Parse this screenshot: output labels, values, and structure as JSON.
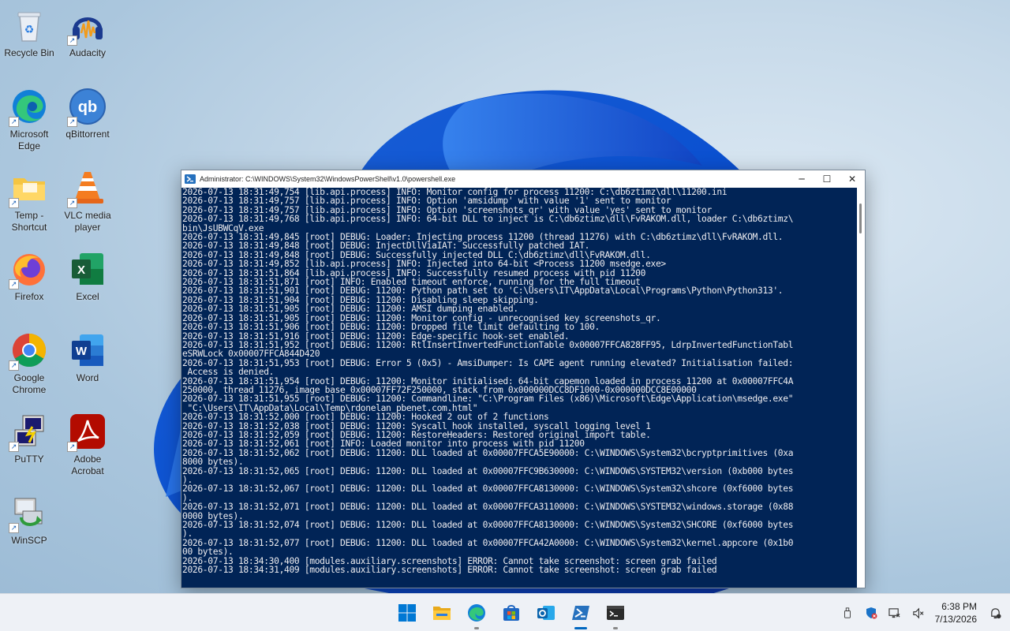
{
  "desktop_icons": [
    {
      "label": "Recycle Bin",
      "icon": "recycle-bin-icon"
    },
    {
      "label": "Audacity",
      "icon": "audacity-icon"
    },
    {
      "label": "Microsoft Edge",
      "icon": "edge-icon"
    },
    {
      "label": "qBittorrent",
      "icon": "qbittorrent-icon"
    },
    {
      "label": "Temp - Shortcut",
      "icon": "folder-icon"
    },
    {
      "label": "VLC media player",
      "icon": "vlc-icon"
    },
    {
      "label": "Firefox",
      "icon": "firefox-icon"
    },
    {
      "label": "Excel",
      "icon": "excel-icon"
    },
    {
      "label": "Google Chrome",
      "icon": "chrome-icon"
    },
    {
      "label": "Word",
      "icon": "word-icon"
    },
    {
      "label": "PuTTY",
      "icon": "putty-icon"
    },
    {
      "label": "Adobe Acrobat",
      "icon": "acrobat-icon"
    },
    {
      "label": "WinSCP",
      "icon": "winscp-icon"
    }
  ],
  "window": {
    "title": "Administrator: C:\\WINDOWS\\System32\\WindowsPowerShell\\v1.0\\powershell.exe",
    "minimize": "─",
    "maximize": "☐",
    "close": "✕"
  },
  "console_text": "2026-07-13 18:31:49,754 [lib.api.process] INFO: Monitor config for process 11200: C:\\db6ztimz\\dll\\11200.ini\n2026-07-13 18:31:49,757 [lib.api.process] INFO: Option 'amsidump' with value '1' sent to monitor\n2026-07-13 18:31:49,757 [lib.api.process] INFO: Option 'screenshots_qr' with value 'yes' sent to monitor\n2026-07-13 18:31:49,768 [lib.api.process] INFO: 64-bit DLL to inject is C:\\db6ztimz\\dll\\FvRAKOM.dll, loader C:\\db6ztimz\\\nbin\\JsUBWCqV.exe\n2026-07-13 18:31:49,845 [root] DEBUG: Loader: Injecting process 11200 (thread 11276) with C:\\db6ztimz\\dll\\FvRAKOM.dll.\n2026-07-13 18:31:49,848 [root] DEBUG: InjectDllViaIAT: Successfully patched IAT.\n2026-07-13 18:31:49,848 [root] DEBUG: Successfully injected DLL C:\\db6ztimz\\dll\\FvRAKOM.dll.\n2026-07-13 18:31:49,852 [lib.api.process] INFO: Injected into 64-bit <Process 11200 msedge.exe>\n2026-07-13 18:31:51,864 [lib.api.process] INFO: Successfully resumed process with pid 11200\n2026-07-13 18:31:51,871 [root] INFO: Enabled timeout enforce, running for the full timeout\n2026-07-13 18:31:51,901 [root] DEBUG: 11200: Python path set to 'C:\\Users\\IT\\AppData\\Local\\Programs\\Python\\Python313'.\n2026-07-13 18:31:51,904 [root] DEBUG: 11200: Disabling sleep skipping.\n2026-07-13 18:31:51,905 [root] DEBUG: 11200: AMSI dumping enabled.\n2026-07-13 18:31:51,905 [root] DEBUG: 11200: Monitor config - unrecognised key screenshots_qr.\n2026-07-13 18:31:51,906 [root] DEBUG: 11200: Dropped file limit defaulting to 100.\n2026-07-13 18:31:51,916 [root] DEBUG: 11200: Edge-specific hook-set enabled.\n2026-07-13 18:31:51,952 [root] DEBUG: 11200: RtlInsertInvertedFunctionTable 0x00007FFCA828FF95, LdrpInvertedFunctionTabl\neSRWLock 0x00007FFCA844D420\n2026-07-13 18:31:51,953 [root] DEBUG: Error 5 (0x5) - AmsiDumper: Is CAPE agent running elevated? Initialisation failed:\n Access is denied.\n2026-07-13 18:31:51,954 [root] DEBUG: 11200: Monitor initialised: 64-bit capemon loaded in process 11200 at 0x00007FFC4A\n250000, thread 11276, image base 0x00007FF72F250000, stack from 0x000000DCC8DF1000-0x000000DCC8E00000\n2026-07-13 18:31:51,955 [root] DEBUG: 11200: Commandline: \"C:\\Program Files (x86)\\Microsoft\\Edge\\Application\\msedge.exe\"\n \"C:\\Users\\IT\\AppData\\Local\\Temp\\rdonelan_pbenet.com.html\"\n2026-07-13 18:31:52,000 [root] DEBUG: 11200: Hooked 2 out of 2 functions\n2026-07-13 18:31:52,038 [root] DEBUG: 11200: Syscall hook installed, syscall logging level 1\n2026-07-13 18:31:52,059 [root] DEBUG: 11200: RestoreHeaders: Restored original import table.\n2026-07-13 18:31:52,061 [root] INFO: Loaded monitor into process with pid 11200\n2026-07-13 18:31:52,062 [root] DEBUG: 11200: DLL loaded at 0x00007FFCA5E90000: C:\\WINDOWS\\System32\\bcryptprimitives (0xa\n8000 bytes).\n2026-07-13 18:31:52,065 [root] DEBUG: 11200: DLL loaded at 0x00007FFC9B630000: C:\\WINDOWS\\SYSTEM32\\version (0xb000 bytes\n).\n2026-07-13 18:31:52,067 [root] DEBUG: 11200: DLL loaded at 0x00007FFCA8130000: C:\\WINDOWS\\System32\\shcore (0xf6000 bytes\n).\n2026-07-13 18:31:52,071 [root] DEBUG: 11200: DLL loaded at 0x00007FFCA3110000: C:\\WINDOWS\\SYSTEM32\\windows.storage (0x88\n0000 bytes).\n2026-07-13 18:31:52,074 [root] DEBUG: 11200: DLL loaded at 0x00007FFCA8130000: C:\\WINDOWS\\System32\\SHCORE (0xf6000 bytes\n).\n2026-07-13 18:31:52,077 [root] DEBUG: 11200: DLL loaded at 0x00007FFCA42A0000: C:\\WINDOWS\\System32\\kernel.appcore (0x1b0\n00 bytes).\n2026-07-13 18:34:30,400 [modules.auxiliary.screenshots] ERROR: Cannot take screenshot: screen grab failed\n2026-07-13 18:34:31,409 [modules.auxiliary.screenshots] ERROR: Cannot take screenshot: screen grab failed",
  "taskbar": {
    "items": [
      {
        "name": "start-icon",
        "active": false
      },
      {
        "name": "file-explorer-icon",
        "active": false
      },
      {
        "name": "edge-icon",
        "active": false,
        "running": true
      },
      {
        "name": "store-icon",
        "active": false
      },
      {
        "name": "outlook-icon",
        "active": false
      },
      {
        "name": "powershell-icon",
        "active": true
      },
      {
        "name": "terminal-icon",
        "active": false,
        "running": true
      }
    ],
    "clock_time": "6:38 PM",
    "clock_date": "7/13/2026"
  },
  "colors": {
    "console_bg": "#012456",
    "console_fg": "#eeedf0",
    "accent": "#0067c0"
  }
}
